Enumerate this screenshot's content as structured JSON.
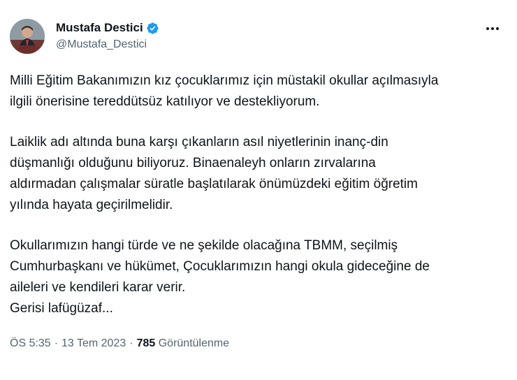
{
  "author": {
    "display_name": "Mustafa Destici",
    "handle": "@Mustafa_Destici",
    "verified_icon": "verified-badge-icon",
    "verified_color": "#1d9bf0"
  },
  "more_icon": "more-horizontal-icon",
  "tweet": {
    "paragraphs": [
      [
        "Milli Eğitim Bakanımızın kız çocuklarımız için müstakil okullar açılmasıyla",
        "ilgili önerisine tereddütsüz katılıyor ve destekliyorum."
      ],
      [
        "Laiklik adı altında buna karşı çıkanların asıl niyetlerinin inanç-din",
        "düşmanlığı olduğunu biliyoruz. Binaenaleyh onların zırvalarına",
        "aldırmadan çalışmalar süratle başlatılarak önümüzdeki eğitim öğretim",
        "yılında hayata geçirilmelidir."
      ],
      [
        "Okullarımızın hangi türde ve ne şekilde olacağına TBMM, seçilmiş",
        "Cumhurbaşkanı ve hükümet, Çocuklarımızın hangi okula gideceğine de",
        "aileleri ve kendileri karar verir.",
        "Gerisi lafügüzaf..."
      ]
    ]
  },
  "meta": {
    "time": "ÖS 5:35",
    "separator": "·",
    "date": "13 Tem 2023",
    "views_count": "785",
    "views_label": "Görüntülenme"
  },
  "colors": {
    "text": "#0f1419",
    "secondary": "#536471"
  }
}
